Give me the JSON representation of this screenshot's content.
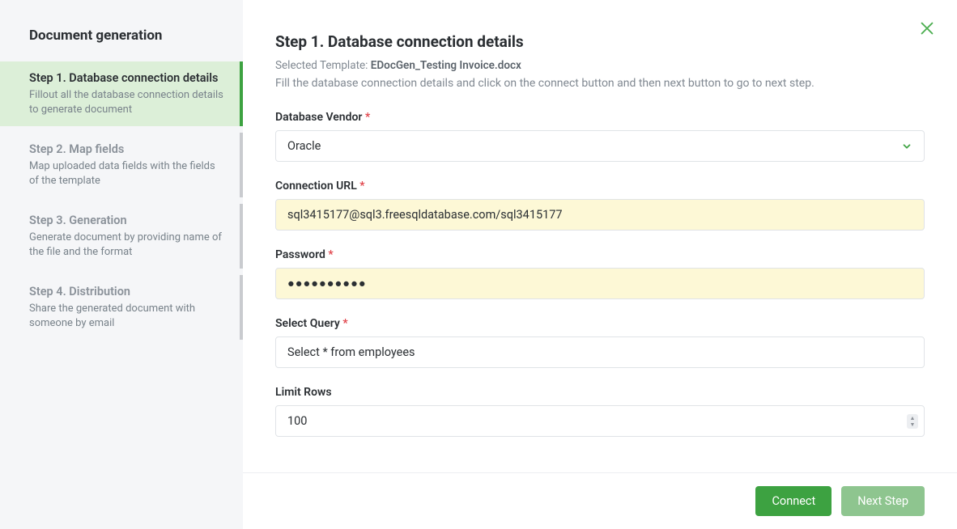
{
  "sidebar": {
    "title": "Document generation",
    "steps": [
      {
        "title": "Step 1. Database connection details",
        "desc": "Fillout all the database connection details to generate document"
      },
      {
        "title": "Step 2. Map fields",
        "desc": "Map uploaded data fields with the fields of the template"
      },
      {
        "title": "Step 3. Generation",
        "desc": "Generate document by providing name of the file and the format"
      },
      {
        "title": "Step 4. Distribution",
        "desc": "Share the generated document with someone by email"
      }
    ]
  },
  "main": {
    "heading": "Step 1. Database connection details",
    "selected_template_label": "Selected Template: ",
    "selected_template_value": "EDocGen_Testing Invoice.docx",
    "instructions": "Fill the database connection details and click on the connect button and then next button to go to next step.",
    "fields": {
      "vendor": {
        "label": "Database Vendor",
        "required": true,
        "value": "Oracle"
      },
      "url": {
        "label": "Connection URL",
        "required": true,
        "value": "sql3415177@sql3.freesqldatabase.com/sql3415177"
      },
      "password": {
        "label": "Password",
        "required": true,
        "value": "●●●●●●●●●●"
      },
      "query": {
        "label": "Select Query",
        "required": true,
        "value": "Select * from employees"
      },
      "limit": {
        "label": "Limit Rows",
        "required": false,
        "value": "100"
      }
    },
    "buttons": {
      "connect": "Connect",
      "next": "Next Step"
    }
  }
}
